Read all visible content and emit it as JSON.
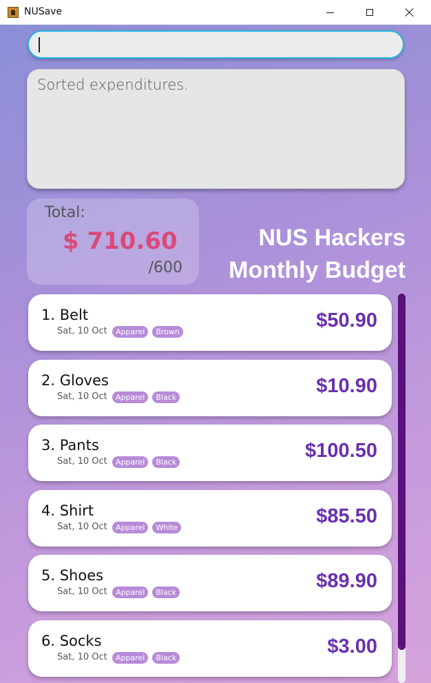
{
  "window": {
    "title": "NUSave"
  },
  "command": {
    "value": "",
    "placeholder": ""
  },
  "result": {
    "text": "Sorted expenditures."
  },
  "total": {
    "label": "Total:",
    "amount": "$ 710.60",
    "budget": "/600"
  },
  "heading": {
    "line1": "NUS Hackers",
    "line2": "Monthly Budget"
  },
  "expenditures": [
    {
      "name": "1. Belt",
      "date": "Sat, 10 Oct",
      "tags": [
        "Apparel",
        "Brown"
      ],
      "price": "$50.90"
    },
    {
      "name": "2. Gloves",
      "date": "Sat, 10 Oct",
      "tags": [
        "Apparel",
        "Black"
      ],
      "price": "$10.90"
    },
    {
      "name": "3. Pants",
      "date": "Sat, 10 Oct",
      "tags": [
        "Apparel",
        "Black"
      ],
      "price": "$100.50"
    },
    {
      "name": "4. Shirt",
      "date": "Sat, 10 Oct",
      "tags": [
        "Apparel",
        "White"
      ],
      "price": "$85.50"
    },
    {
      "name": "5. Shoes",
      "date": "Sat, 10 Oct",
      "tags": [
        "Apparel",
        "Black"
      ],
      "price": "$89.90"
    },
    {
      "name": "6. Socks",
      "date": "Sat, 10 Oct",
      "tags": [
        "Apparel",
        "Black"
      ],
      "price": "$3.00"
    }
  ],
  "colors": {
    "accent": "#6a2fb0",
    "total_amount": "#d84a7a",
    "tag": "#b78bd8",
    "scroll_thumb": "#5a117c"
  },
  "icons": {
    "app": "app-icon",
    "minimize": "minimize-icon",
    "maximize": "maximize-icon",
    "close": "close-icon"
  }
}
